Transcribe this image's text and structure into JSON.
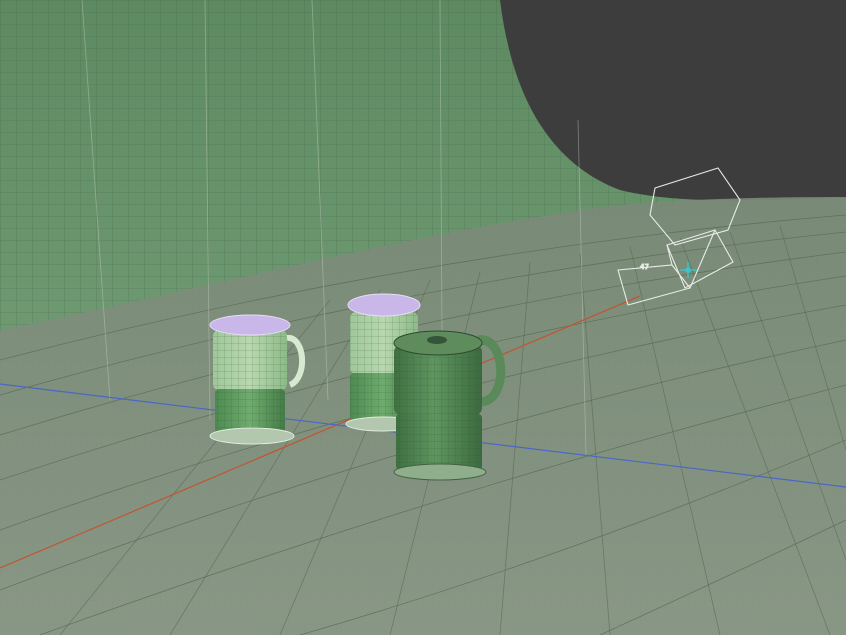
{
  "viewport": {
    "background_color": "#3d3d3d",
    "backdrop_color": "#6f9a72",
    "floor_color": "#7e8c7b",
    "wire_color": "#42543f",
    "x_axis_color": "#c3532f",
    "y_axis_color": "#4a67c8"
  },
  "objects": [
    {
      "name": "pitcher-left",
      "state": "selected",
      "color": "#7faa7c"
    },
    {
      "name": "pitcher-middle",
      "state": "selected",
      "color": "#7faa7c"
    },
    {
      "name": "pitcher-front",
      "state": "active",
      "color": "#5f8f5f"
    }
  ],
  "camera": {
    "name": "camera-icon",
    "label": "47"
  },
  "origin_marker": {
    "name": "3d-cursor-icon",
    "color": "#34c9d4"
  }
}
